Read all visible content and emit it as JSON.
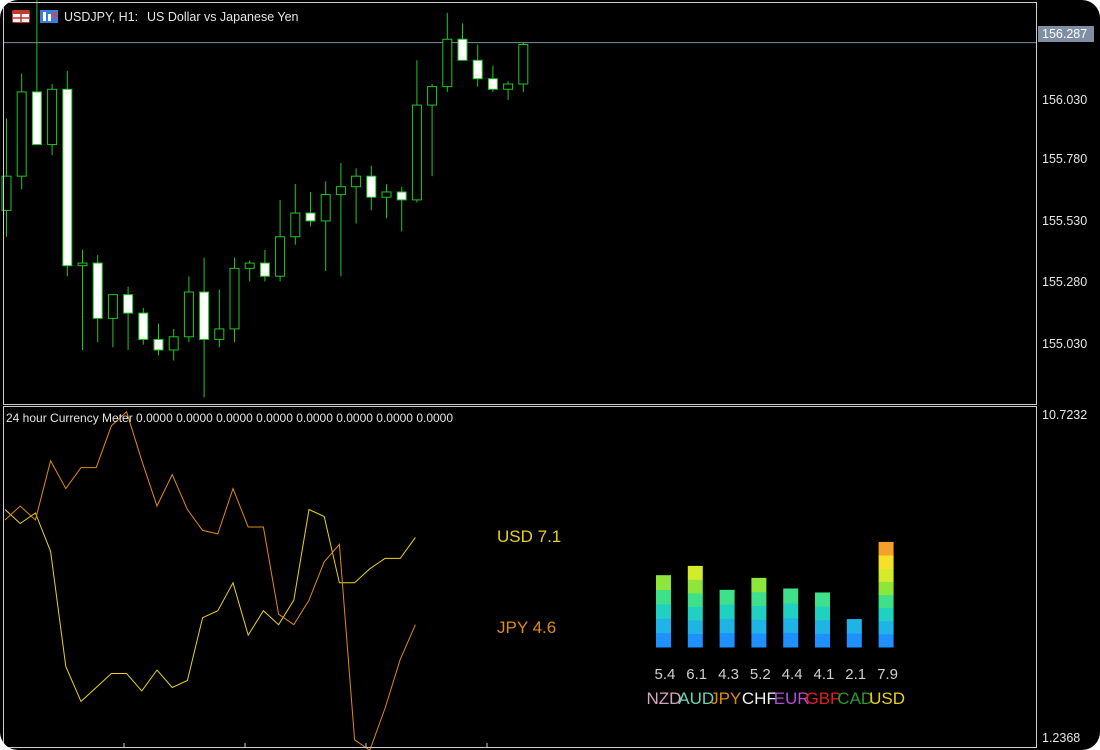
{
  "chart_header": {
    "symbol_label": "USDJPY, H1:",
    "description": "US Dollar vs Japanese Yen"
  },
  "price_axis": {
    "ticks": [
      "156.030",
      "155.780",
      "155.530",
      "155.280",
      "155.030"
    ],
    "current_price": "156.287"
  },
  "indicator": {
    "header": "24 hour Currency Meter 0.0000 0.0000 0.0000 0.0000 0.0000 0.0000 0.0000 0.0000",
    "axis_top": "10.7232",
    "axis_bottom": "1.2368",
    "line_labels": [
      {
        "text": "USD 7.1",
        "color": "#e8d21a"
      },
      {
        "text": "JPY 4.6",
        "color": "#e08a12"
      }
    ],
    "meter": {
      "currencies": [
        {
          "name": "NZD",
          "value": 5.4,
          "value_text": "5.4",
          "color": "#d9a3c2"
        },
        {
          "name": "AUD",
          "value": 6.1,
          "value_text": "6.1",
          "color": "#68d6b5"
        },
        {
          "name": "JPY",
          "value": 4.3,
          "value_text": "4.3",
          "color": "#e08a12"
        },
        {
          "name": "CHF",
          "value": 5.2,
          "value_text": "5.2",
          "color": "#f2f2f2"
        },
        {
          "name": "EUR",
          "value": 4.4,
          "value_text": "4.4",
          "color": "#b050d0"
        },
        {
          "name": "GBP",
          "value": 4.1,
          "value_text": "4.1",
          "color": "#e02020"
        },
        {
          "name": "CAD",
          "value": 2.1,
          "value_text": "2.1",
          "color": "#2a9a2a"
        },
        {
          "name": "USD",
          "value": 7.9,
          "value_text": "7.9",
          "color": "#e8d21a"
        }
      ]
    }
  },
  "chart_data": [
    {
      "type": "candlestick",
      "ylim": [
        154.93,
        156.43
      ],
      "candles": [
        {
          "o": 155.65,
          "h": 156.0,
          "l": 155.55,
          "c": 155.78
        },
        {
          "o": 155.78,
          "h": 156.17,
          "l": 155.73,
          "c": 156.1
        },
        {
          "o": 156.1,
          "h": 156.45,
          "l": 155.95,
          "c": 155.9
        },
        {
          "o": 155.9,
          "h": 156.13,
          "l": 155.86,
          "c": 156.11
        },
        {
          "o": 156.11,
          "h": 156.18,
          "l": 155.4,
          "c": 155.44
        },
        {
          "o": 155.44,
          "h": 155.5,
          "l": 155.12,
          "c": 155.45
        },
        {
          "o": 155.45,
          "h": 155.48,
          "l": 155.15,
          "c": 155.24
        },
        {
          "o": 155.24,
          "h": 155.3,
          "l": 155.13,
          "c": 155.33
        },
        {
          "o": 155.33,
          "h": 155.36,
          "l": 155.12,
          "c": 155.26
        },
        {
          "o": 155.26,
          "h": 155.28,
          "l": 155.14,
          "c": 155.16
        },
        {
          "o": 155.16,
          "h": 155.22,
          "l": 155.1,
          "c": 155.12
        },
        {
          "o": 155.12,
          "h": 155.2,
          "l": 155.08,
          "c": 155.17
        },
        {
          "o": 155.17,
          "h": 155.4,
          "l": 155.15,
          "c": 155.34
        },
        {
          "o": 155.34,
          "h": 155.47,
          "l": 154.94,
          "c": 155.16
        },
        {
          "o": 155.16,
          "h": 155.35,
          "l": 155.13,
          "c": 155.2
        },
        {
          "o": 155.2,
          "h": 155.47,
          "l": 155.15,
          "c": 155.43
        },
        {
          "o": 155.43,
          "h": 155.46,
          "l": 155.38,
          "c": 155.45
        },
        {
          "o": 155.45,
          "h": 155.5,
          "l": 155.38,
          "c": 155.4
        },
        {
          "o": 155.4,
          "h": 155.69,
          "l": 155.38,
          "c": 155.55
        },
        {
          "o": 155.55,
          "h": 155.75,
          "l": 155.52,
          "c": 155.64
        },
        {
          "o": 155.64,
          "h": 155.72,
          "l": 155.59,
          "c": 155.61
        },
        {
          "o": 155.61,
          "h": 155.76,
          "l": 155.42,
          "c": 155.71
        },
        {
          "o": 155.71,
          "h": 155.83,
          "l": 155.4,
          "c": 155.74
        },
        {
          "o": 155.74,
          "h": 155.81,
          "l": 155.6,
          "c": 155.78
        },
        {
          "o": 155.78,
          "h": 155.82,
          "l": 155.65,
          "c": 155.7
        },
        {
          "o": 155.7,
          "h": 155.75,
          "l": 155.62,
          "c": 155.72
        },
        {
          "o": 155.72,
          "h": 155.74,
          "l": 155.57,
          "c": 155.69
        },
        {
          "o": 155.69,
          "h": 156.22,
          "l": 155.68,
          "c": 156.05
        },
        {
          "o": 156.05,
          "h": 156.13,
          "l": 155.78,
          "c": 156.12
        },
        {
          "o": 156.12,
          "h": 156.4,
          "l": 156.1,
          "c": 156.3
        },
        {
          "o": 156.3,
          "h": 156.36,
          "l": 156.25,
          "c": 156.22
        },
        {
          "o": 156.22,
          "h": 156.28,
          "l": 156.12,
          "c": 156.15
        },
        {
          "o": 156.15,
          "h": 156.2,
          "l": 156.1,
          "c": 156.11
        },
        {
          "o": 156.11,
          "h": 156.14,
          "l": 156.07,
          "c": 156.13
        },
        {
          "o": 156.13,
          "h": 156.29,
          "l": 156.1,
          "c": 156.28
        }
      ],
      "current_price": 156.287
    },
    {
      "type": "line",
      "ylim": [
        1.2368,
        10.7232
      ],
      "series": [
        {
          "name": "USD",
          "color": "#e8d21a",
          "values": [
            7.9,
            7.5,
            7.8,
            6.7,
            3.4,
            2.4,
            2.8,
            3.2,
            3.2,
            2.7,
            3.3,
            2.8,
            3.0,
            4.8,
            5.0,
            5.8,
            4.3,
            5.0,
            4.6,
            5.3,
            7.9,
            7.7,
            5.8,
            5.8,
            6.2,
            6.5,
            6.5,
            7.1
          ]
        },
        {
          "name": "JPY",
          "color": "#e08a12",
          "values": [
            7.6,
            8.0,
            7.6,
            9.3,
            8.5,
            9.1,
            9.1,
            10.3,
            10.7,
            9.3,
            8.0,
            8.9,
            7.9,
            7.3,
            7.2,
            8.5,
            7.4,
            7.4,
            4.9,
            4.6,
            5.3,
            6.4,
            6.9,
            1.3,
            1.0,
            2.2,
            3.6,
            4.6
          ]
        }
      ]
    }
  ]
}
